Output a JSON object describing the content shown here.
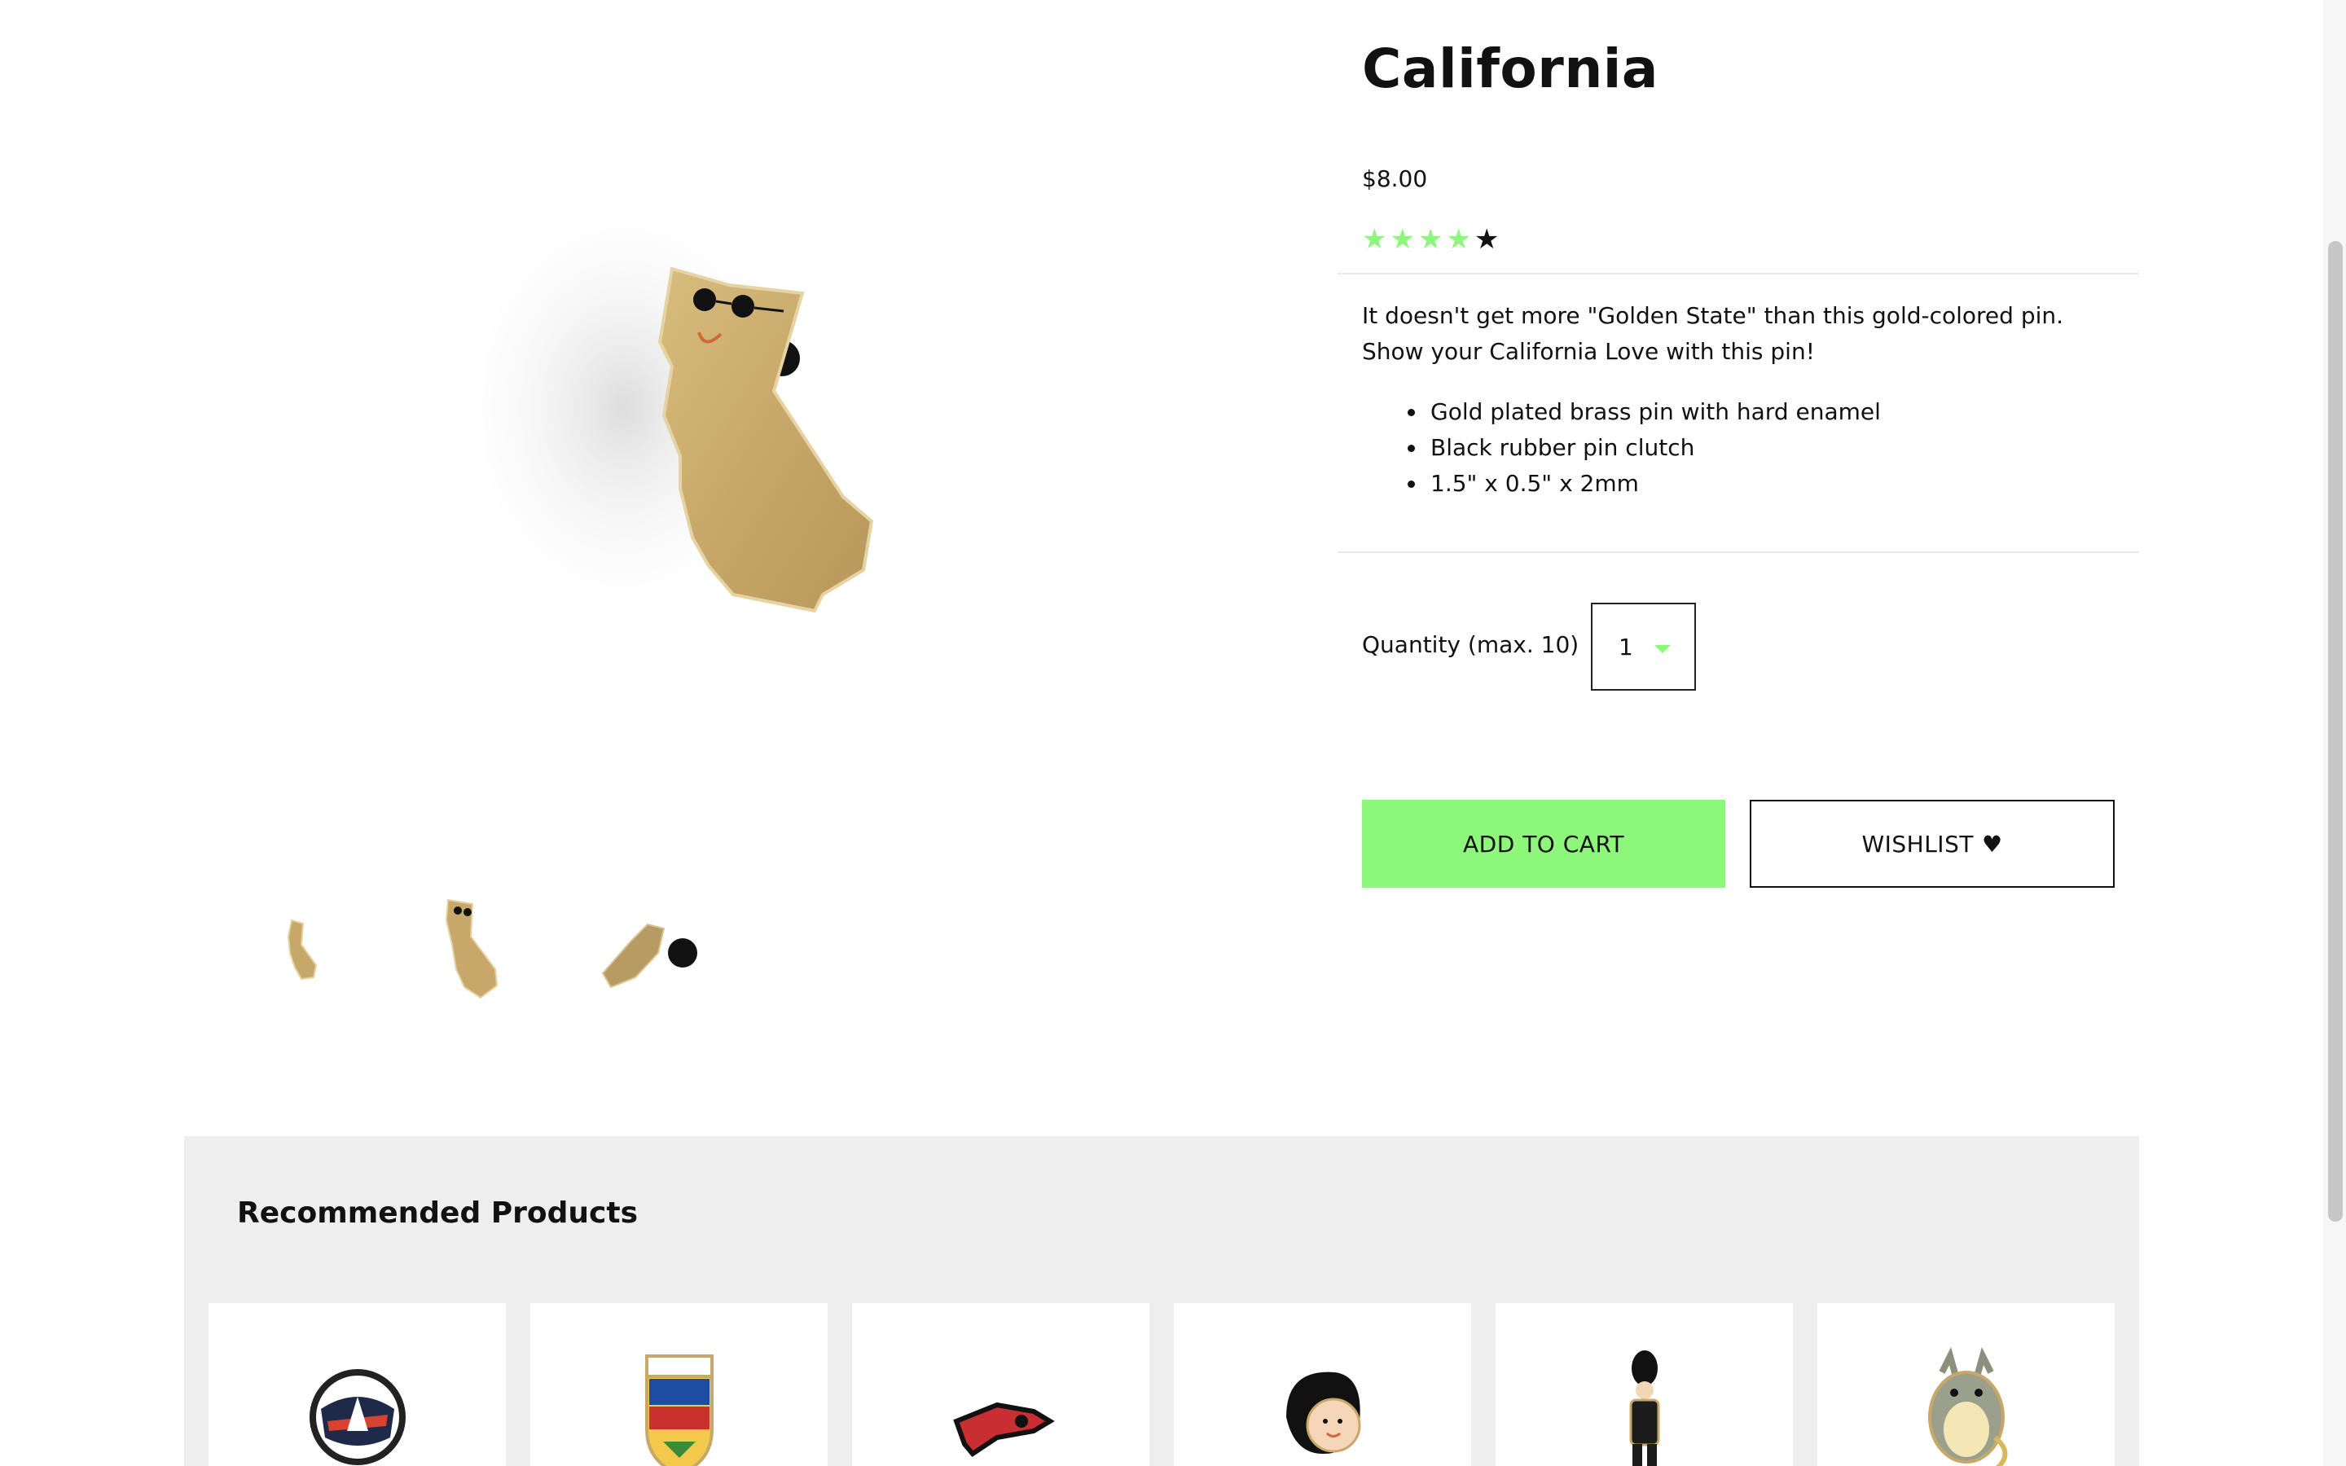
{
  "product": {
    "title": "California",
    "price": "$8.00",
    "rating": {
      "filled": 4,
      "total": 5,
      "filled_color": "#8cf77a",
      "empty_color": "#111111"
    },
    "description": "It doesn't get more \"Golden State\" than this gold-colored pin. Show your California Love with this pin!",
    "features": [
      "Gold plated brass pin with hard enamel",
      "Black rubber pin clutch",
      "1.5\" x 0.5\" x 2mm"
    ]
  },
  "quantity": {
    "label": "Quantity (max. 10)",
    "selected": "1"
  },
  "actions": {
    "add_to_cart": "ADD TO CART",
    "wishlist": "WISHLIST",
    "wishlist_icon": "heart-icon"
  },
  "recommended": {
    "title": "Recommended Products"
  },
  "colors": {
    "accent": "#8cf77a",
    "panel": "#eeeeee",
    "gold": "#c9aa6a"
  }
}
